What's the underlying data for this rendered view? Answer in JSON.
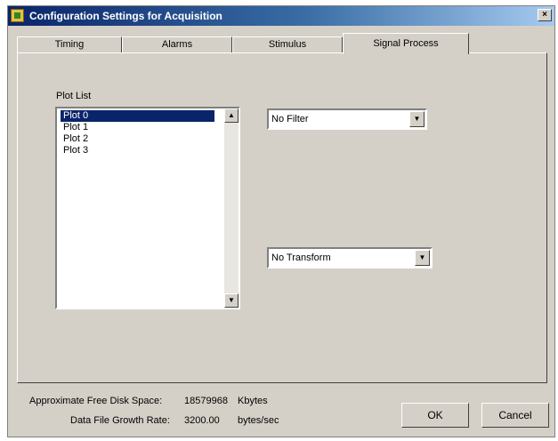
{
  "window": {
    "title": "Configuration Settings for Acquisition",
    "close_glyph": "×"
  },
  "tabs": [
    {
      "label": "Timing",
      "active": false
    },
    {
      "label": "Alarms",
      "active": false
    },
    {
      "label": "Stimulus",
      "active": false
    },
    {
      "label": "Signal Process",
      "active": true
    }
  ],
  "plot_list": {
    "label": "Plot List",
    "items": [
      "Plot 0",
      "Plot 1",
      "Plot 2",
      "Plot 3"
    ],
    "selected": "Plot 0"
  },
  "filter_select": {
    "value": "No Filter"
  },
  "transform_select": {
    "value": "No Transform"
  },
  "footer": {
    "disk_space_label": "Approximate Free Disk Space:",
    "disk_space_value": "18579968",
    "disk_space_unit": "Kbytes",
    "growth_label": "Data File Growth Rate:",
    "growth_value": "3200.00",
    "growth_unit": "bytes/sec"
  },
  "buttons": {
    "ok": "OK",
    "cancel": "Cancel"
  },
  "icons": {
    "app": "app-icon",
    "close": "close-icon",
    "scroll_up": "scroll-up-icon",
    "scroll_down": "scroll-down-icon",
    "dropdown": "chevron-down-icon"
  },
  "colors": {
    "title_bar": "#0a246a",
    "dialog_bg": "#d4d0c8",
    "selection": "#0a246a"
  }
}
